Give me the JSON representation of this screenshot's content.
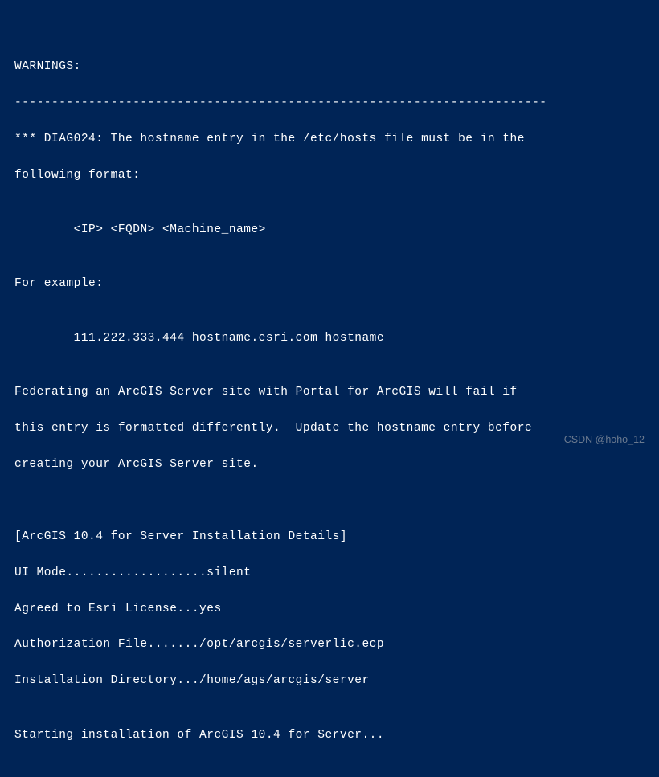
{
  "terminal": {
    "lines": [
      "WARNINGS:",
      "------------------------------------------------------------------------",
      "*** DIAG024: The hostname entry in the /etc/hosts file must be in the",
      "following format:",
      "",
      "        <IP> <FQDN> <Machine_name>",
      "",
      "For example:",
      "",
      "        111.222.333.444 hostname.esri.com hostname",
      "",
      "Federating an ArcGIS Server site with Portal for ArcGIS will fail if",
      "this entry is formatted differently.  Update the hostname entry before",
      "creating your ArcGIS Server site.",
      "",
      "",
      "[ArcGIS 10.4 for Server Installation Details]",
      "UI Mode...................silent",
      "Agreed to Esri License...yes",
      "Authorization File......./opt/arcgis/serverlic.ecp",
      "Installation Directory.../home/ags/arcgis/server",
      "",
      "Starting installation of ArcGIS 10.4 for Server..."
    ]
  },
  "watermark": "CSDN @hoho_12"
}
